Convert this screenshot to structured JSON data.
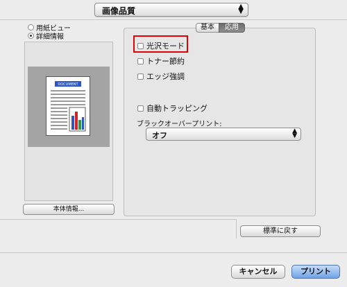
{
  "top_popup": {
    "selected": "画像品質"
  },
  "view_options": {
    "paper_view": "用紙ビュー",
    "detail_info": "詳細情報"
  },
  "preview": {
    "doc_title": "DOCUMENT",
    "bar_colors": [
      "#2b55c8",
      "#d22222",
      "#2e9b3b"
    ],
    "info_button": "本体情報..."
  },
  "tabs": {
    "basic": "基本",
    "apply": "応用"
  },
  "options": {
    "gloss_mode": "光沢モード",
    "toner_save": "トナー節約",
    "edge_enhance": "エッジ強調",
    "auto_trapping": "自動トラッピング",
    "black_overprint_label": "ブラックオーバープリント:",
    "black_overprint_value": "オフ"
  },
  "buttons": {
    "reset": "標準に戻す",
    "cancel": "キャンセル",
    "print": "プリント"
  },
  "colors": {
    "highlight": "#e40000",
    "print_button": "#6fa2e7"
  }
}
